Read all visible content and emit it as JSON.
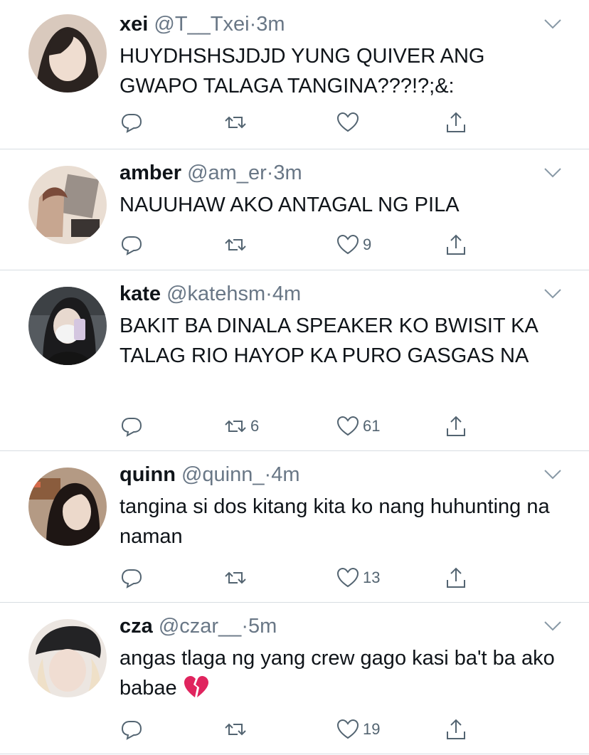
{
  "tweets": [
    {
      "name": "xei",
      "handle": "@T__Txei",
      "dot": "·",
      "time": "3m",
      "text": "HUYDHSHSJDJD YUNG QUIVER ANG GWAPO TALAGA TANGINA???!?;&:",
      "replies": "",
      "retweets": "",
      "likes": ""
    },
    {
      "name": "amber",
      "handle": "@am_er",
      "dot": "·",
      "time": "3m",
      "text": "NAUUHAW AKO ANTAGAL NG PILA",
      "replies": "",
      "retweets": "",
      "likes": "9"
    },
    {
      "name": "kate",
      "handle": "@katehsm",
      "dot": "·",
      "time": "4m",
      "text": "BAKIT BA DINALA SPEAKER KO BWISIT KA TALAG RIO HAYOP KA PURO GASGAS NA",
      "replies": "",
      "retweets": "6",
      "likes": "61"
    },
    {
      "name": "quinn",
      "handle": "@quinn_",
      "dot": "·",
      "time": "4m",
      "text": "tangina si dos kitang kita ko nang huhunting na naman",
      "replies": "",
      "retweets": "",
      "likes": "13"
    },
    {
      "name": "cza",
      "handle": "@czar__",
      "dot": "·",
      "time": "5m",
      "text": "angas tlaga ng yang crew gago kasi ba't ba ako babae",
      "replies": "",
      "retweets": "",
      "likes": "19",
      "emoji": "broken-heart"
    }
  ],
  "icons": {
    "reply": "reply-icon",
    "retweet": "retweet-icon",
    "like": "heart-icon",
    "share": "share-icon",
    "menu": "chevron-down-icon"
  },
  "colors": {
    "text": "#0f1419",
    "secondary": "#697786",
    "divider": "#d8dde2",
    "broken_heart": "#e0245e"
  }
}
